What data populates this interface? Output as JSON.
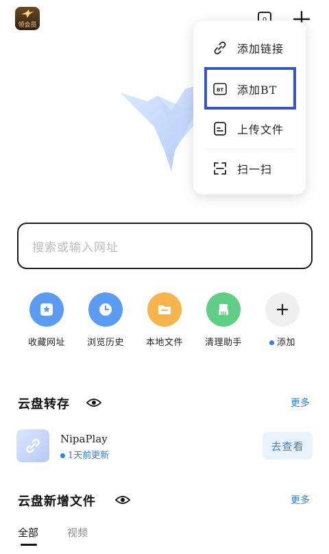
{
  "header": {
    "vip_badge_label": "领会员",
    "message_count": "0",
    "icons": {
      "bird": "bird-logo-icon",
      "message": "message-icon",
      "add": "plus-icon"
    }
  },
  "popup_menu": {
    "items": [
      {
        "label": "添加链接",
        "icon": "link-icon"
      },
      {
        "label": "添加BT",
        "icon": "bt-icon",
        "icon_text": "BT"
      },
      {
        "label": "上传文件",
        "icon": "document-icon"
      },
      {
        "label": "扫一扫",
        "icon": "scan-icon"
      }
    ],
    "highlight_color": "#3454d1"
  },
  "search": {
    "placeholder": "搜索或输入网址"
  },
  "shortcuts": [
    {
      "label": "收藏网址",
      "icon": "bookmark-star-icon",
      "color": "#5a9bf3"
    },
    {
      "label": "浏览历史",
      "icon": "clock-icon",
      "color": "#5a9bf3"
    },
    {
      "label": "本地文件",
      "icon": "folder-icon",
      "color": "#f6b44a"
    },
    {
      "label": "清理助手",
      "icon": "broom-icon",
      "color": "#5fcf86"
    },
    {
      "label": "添加",
      "icon": "plus-icon",
      "color": "#efefef"
    }
  ],
  "cloud_transfer": {
    "title": "云盘转存",
    "more": "更多",
    "item": {
      "name": "NipaPlay",
      "subtitle": "1天前更新",
      "action": "去查看"
    }
  },
  "cloud_new_files": {
    "title": "云盘新增文件",
    "more": "更多",
    "tabs": [
      "全部",
      "视频"
    ]
  },
  "colors": {
    "accent": "#2f7fe6",
    "text": "#1a1a1a"
  }
}
